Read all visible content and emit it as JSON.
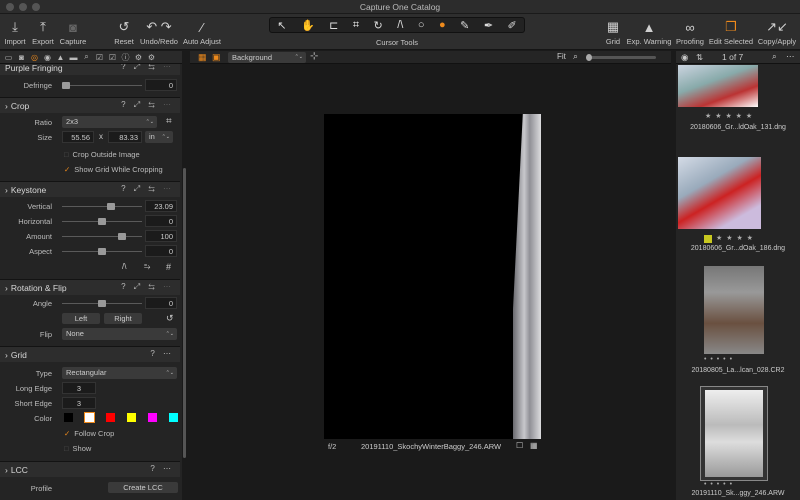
{
  "window": {
    "title": "Capture One Catalog"
  },
  "toolbar": {
    "import": "Import",
    "export": "Export",
    "capture": "Capture",
    "reset": "Reset",
    "undo_redo": "Undo/Redo",
    "auto_adjust": "Auto Adjust",
    "cursor_tools": "Cursor Tools",
    "grid": "Grid",
    "exp_warning": "Exp. Warning",
    "proofing": "Proofing",
    "edit_selected": "Edit Selected",
    "copy_apply": "Copy/Apply"
  },
  "left": {
    "purple": {
      "title": "Purple Fringing",
      "defringe_label": "Defringe",
      "defringe_value": "0"
    },
    "crop": {
      "title": "Crop",
      "ratio_label": "Ratio",
      "ratio_value": "2x3",
      "size_label": "Size",
      "width": "55.56",
      "x": "x",
      "height": "83.33",
      "unit": "in",
      "outside": "Crop Outside Image",
      "showgrid": "Show Grid While Cropping"
    },
    "keystone": {
      "title": "Keystone",
      "rows": [
        {
          "label": "Vertical",
          "value": "23.09",
          "level": 0.62
        },
        {
          "label": "Horizontal",
          "value": "0",
          "level": 0.5
        },
        {
          "label": "Amount",
          "value": "100",
          "level": 0.78
        },
        {
          "label": "Aspect",
          "value": "0",
          "level": 0.5
        }
      ]
    },
    "rotation": {
      "title": "Rotation & Flip",
      "angle_label": "Angle",
      "angle_value": "0",
      "left": "Left",
      "right": "Right",
      "flip_label": "Flip",
      "flip_value": "None"
    },
    "grid": {
      "title": "Grid",
      "type_label": "Type",
      "type_value": "Rectangular",
      "long_label": "Long Edge",
      "long_value": "3",
      "short_label": "Short Edge",
      "short_value": "3",
      "color_label": "Color",
      "follow": "Follow Crop",
      "show": "Show",
      "colors": [
        "#000000",
        "#ffffff",
        "#ff0000",
        "#ffff00",
        "#ff00ff",
        "#00ffff"
      ]
    },
    "lcc": {
      "title": "LCC",
      "profile_label": "Profile",
      "create": "Create LCC"
    }
  },
  "viewer": {
    "background": "Background",
    "fit": "Fit",
    "aperture": "f/2",
    "filename": "20191110_SkochyWinterBaggy_246.ARW"
  },
  "browser": {
    "count": "1 of 7",
    "items": [
      {
        "name": "20180606_Gr...ldOak_131.dng",
        "stars": "★ ★ ★ ★ ★"
      },
      {
        "name": "20180606_Gr...dOak_186.dng",
        "stars": "★ ★ ★ ★"
      },
      {
        "name": "20180805_La...lcan_028.CR2",
        "stars": "• • • • •"
      },
      {
        "name": "20191110_Sk...ggy_246.ARW",
        "stars": "• • • • •"
      }
    ]
  }
}
